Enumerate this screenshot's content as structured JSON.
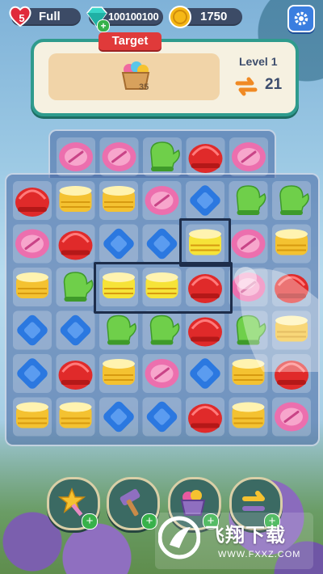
{
  "hud": {
    "lives": "5",
    "lives_status": "Full",
    "gems": "100100100",
    "coins": "1750",
    "settings_icon": "gear-icon"
  },
  "target_panel": {
    "tag": "Target",
    "item_icon": "yarn-basket-icon",
    "item_count": "35",
    "level": "Level 1",
    "moves_icon": "swap-arrows-icon",
    "moves": "21"
  },
  "board": {
    "top_row": [
      "button",
      "button",
      "mitten",
      "hat",
      "button"
    ],
    "rows": [
      [
        "hat",
        "spool",
        "spool",
        "button",
        "diamond",
        "mitten",
        "mitten"
      ],
      [
        "button",
        "hat",
        "diamond",
        "diamond",
        "spool-yellow",
        "button",
        "spool"
      ],
      [
        "spool",
        "mitten",
        "spool-yellow",
        "spool-yellow",
        "hat",
        "button",
        "hat"
      ],
      [
        "diamond",
        "diamond",
        "mitten",
        "mitten",
        "hat",
        "mitten",
        "spool"
      ],
      [
        "diamond",
        "hat",
        "spool",
        "button",
        "diamond",
        "spool",
        "hat"
      ],
      [
        "spool",
        "spool",
        "diamond",
        "diamond",
        "hat",
        "spool",
        "button"
      ]
    ]
  },
  "boosters": [
    {
      "icon": "star-wand-icon"
    },
    {
      "icon": "hammer-icon"
    },
    {
      "icon": "yarn-basket-icon"
    },
    {
      "icon": "swap-arrow-icon"
    }
  ],
  "colors": {
    "hat": "#e02a2a",
    "button": "#ec6fae",
    "mitten": "#6fcf4a",
    "diamond": "#2b78e0",
    "spool": "#f4c231",
    "spool-yellow": "#f6e338",
    "panel_border": "#2f9b8d",
    "tag": "#e03a3a"
  },
  "watermark": {
    "title": "飞翔下载",
    "url": "WWW.FXXZ.COM"
  }
}
